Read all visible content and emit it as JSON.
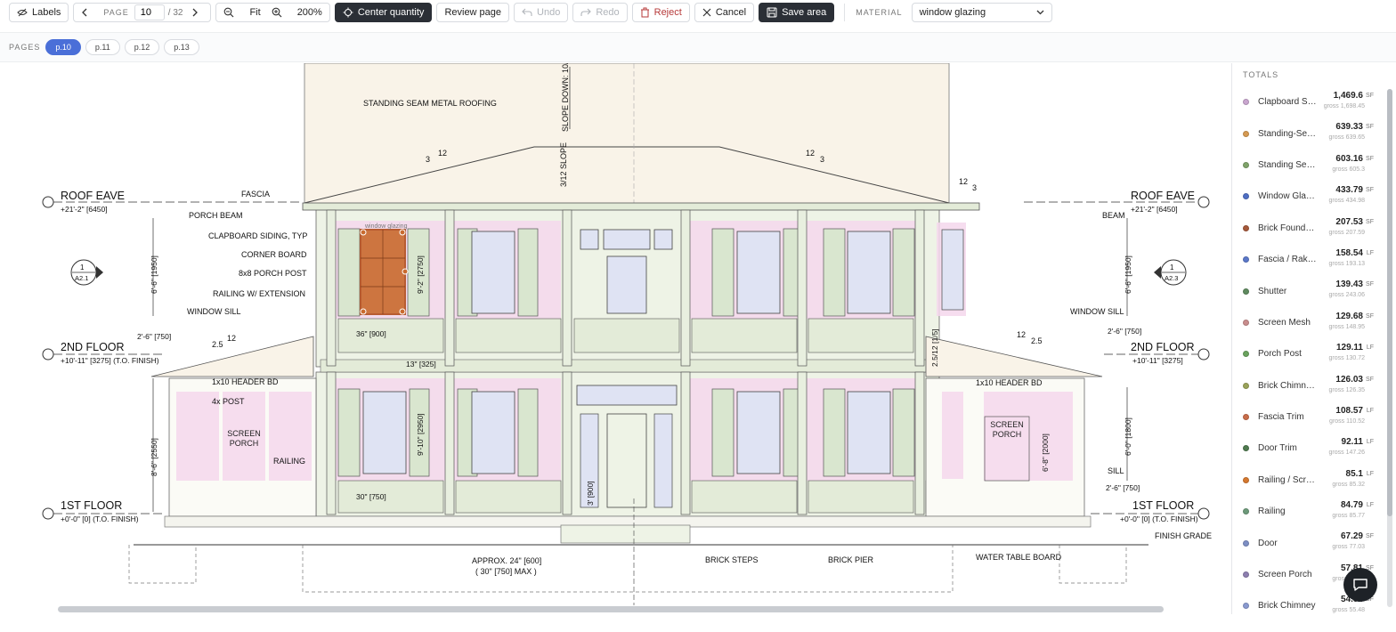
{
  "toolbar": {
    "labels": "Labels",
    "page_label": "PAGE",
    "page_value": "10",
    "page_total": "/ 32",
    "fit": "Fit",
    "zoom": "200%",
    "center_quantity": "Center quantity",
    "review_page": "Review page",
    "undo": "Undo",
    "redo": "Redo",
    "reject": "Reject",
    "cancel": "Cancel",
    "save_area": "Save area",
    "material_label": "MATERIAL",
    "material_value": "window glazing"
  },
  "pages": {
    "label": "PAGES",
    "items": [
      {
        "label": "p.10",
        "active": true
      },
      {
        "label": "p.11",
        "active": false
      },
      {
        "label": "p.12",
        "active": false
      },
      {
        "label": "p.13",
        "active": false
      }
    ]
  },
  "drawing": {
    "roof_eave": "ROOF EAVE",
    "roof_eave_elev": "+21'-2\" [6450]",
    "second_floor": "2ND FLOOR",
    "second_floor_elev": "+10'-11\" [3275] (T.O. FINISH)",
    "second_floor_elev_r": "+10'-11\" [3275]",
    "first_floor": "1ST FLOOR",
    "first_floor_elev": "+0'-0\" [0] (T.O. FINISH)",
    "standing_seam": "STANDING SEAM METAL ROOFING",
    "slope_down": "SLOPE DOWN: 10/12 [4/5]",
    "slope_small": "3/12 SLOPE",
    "fascia": "FASCIA",
    "porch_beam": "PORCH BEAM",
    "beam": "BEAM",
    "clapboard": "CLAPBOARD SIDING, TYP",
    "corner_board": "CORNER BOARD",
    "porch_post": "8x8 PORCH POST",
    "railing_ext": "RAILING W/ EXTENSION",
    "window_sill": "WINDOW SILL",
    "header_bd": "1x10 HEADER BD",
    "header_bd_r": "1x10  HEADER BD",
    "post4": "4x  POST",
    "screen_porch": "SCREEN PORCH",
    "screen_porch_r": "SCREEN PORCH",
    "railing": "RAILING",
    "sill": "SILL",
    "brick_steps": "BRICK STEPS",
    "brick_pier": "BRICK PIER",
    "water_table": "WATER TABLE BOARD",
    "finish_grade": "FINISH GRADE",
    "approx": "APPROX. 24\" [600]",
    "approx_max": "( 30\" [750] MAX )",
    "dim_6_6": "6'-6\" [1950]",
    "dim_8_6": "8'-6\" [2550]",
    "dim_6_0": "6'-0\" [1800]",
    "dim_2_6": "2'-6\" [750]",
    "dim_36": "36\" [900]",
    "dim_30": "30\" [750]",
    "dim_13": "13\" [325]",
    "dim_9_2": "9'-2\" [2750]",
    "dim_9_10": "9'-10\" [2950]",
    "dim_6_8": "6'-8\" [2000]",
    "dim_3": "3' [900]",
    "dim_25_12": "2.5/12 [1/5]",
    "pitch_12": "12",
    "pitch_3": "3",
    "pitch_25": "2.5",
    "tag_window_glazing": "window glazing",
    "sec_left_num": "1",
    "sec_left_sheet": "A2.1",
    "sec_right_num": "1",
    "sec_right_sheet": "A2.3"
  },
  "totals": {
    "title": "TOTALS",
    "items": [
      {
        "name": "Clapboard Siding",
        "value": "1,469.6",
        "unit": "SF",
        "gross": "gross 1,698.45",
        "color": "#c9a6cf"
      },
      {
        "name": "Standing-Seam Roof",
        "value": "639.33",
        "unit": "SF",
        "gross": "gross 639.65",
        "color": "#d59a52"
      },
      {
        "name": "Standing Seam Fascia",
        "value": "603.16",
        "unit": "SF",
        "gross": "gross 605.3",
        "color": "#7fa36a"
      },
      {
        "name": "Window Glazing",
        "value": "433.79",
        "unit": "SF",
        "gross": "gross 434.98",
        "color": "#4f6fc4"
      },
      {
        "name": "Brick Foundation",
        "value": "207.53",
        "unit": "SF",
        "gross": "gross 207.59",
        "color": "#a5593a"
      },
      {
        "name": "Fascia / Rake Board",
        "value": "158.54",
        "unit": "LF",
        "gross": "gross 193.13",
        "color": "#5b78c9"
      },
      {
        "name": "Shutter",
        "value": "139.43",
        "unit": "SF",
        "gross": "gross 243.06",
        "color": "#5f8a5f"
      },
      {
        "name": "Screen Mesh",
        "value": "129.68",
        "unit": "SF",
        "gross": "gross 148.95",
        "color": "#c98d8d"
      },
      {
        "name": "Porch Post",
        "value": "129.11",
        "unit": "LF",
        "gross": "gross 130.72",
        "color": "#6aa35e"
      },
      {
        "name": "Brick Chimney Cap",
        "value": "126.03",
        "unit": "SF",
        "gross": "gross 126.35",
        "color": "#9aa35a"
      },
      {
        "name": "Fascia Trim",
        "value": "108.57",
        "unit": "LF",
        "gross": "gross 110.52",
        "color": "#c96d4a"
      },
      {
        "name": "Door Trim",
        "value": "92.11",
        "unit": "LF",
        "gross": "gross 147.26",
        "color": "#4f7a4f"
      },
      {
        "name": "Railing / Screen",
        "value": "85.1",
        "unit": "LF",
        "gross": "gross 85.32",
        "color": "#d5782f"
      },
      {
        "name": "Railing",
        "value": "84.79",
        "unit": "LF",
        "gross": "gross 85.77",
        "color": "#6d9a7a"
      },
      {
        "name": "Door",
        "value": "67.29",
        "unit": "SF",
        "gross": "gross 77.03",
        "color": "#7d8fc4"
      },
      {
        "name": "Screen Porch",
        "value": "57.81",
        "unit": "SF",
        "gross": "gross 58.62",
        "color": "#8d7fb0"
      },
      {
        "name": "Brick Chimney",
        "value": "54.84",
        "unit": "SF",
        "gross": "gross 55.48",
        "color": "#8a9ad0"
      }
    ]
  }
}
